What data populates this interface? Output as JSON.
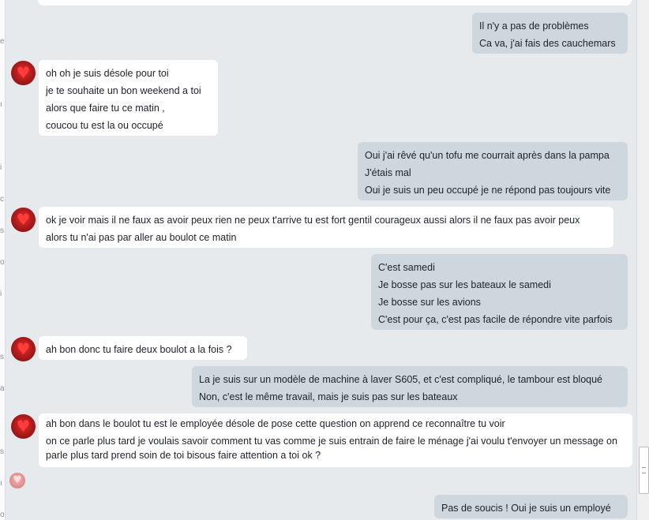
{
  "messages": [
    {
      "side": "out",
      "lines": [
        "Il n'y a pas de problèmes",
        "Ca va, j'ai fais des cauchemars"
      ]
    },
    {
      "side": "in",
      "lines": [
        "oh oh je suis désole  pour toi",
        "je te souhaite un bon weekend a toi",
        "alors que faire tu ce matin ,",
        "coucou tu est la ou occupé"
      ]
    },
    {
      "side": "out",
      "lines": [
        "Oui j'ai rêvé qu'un tofu me courrait après dans la pampa",
        "J'étais mal",
        "Oui je suis un peu occupé je ne répond pas toujours vite"
      ]
    },
    {
      "side": "in",
      "lines": [
        "ok je voir mais il ne faux as avoir peux rien ne peux t'arrive  tu est fort gentil courageux aussi alors il ne faux pas avoir peux",
        "alors tu n'ai pas par aller au boulot ce matin"
      ]
    },
    {
      "side": "out",
      "lines": [
        "C'est samedi",
        "Je bosse pas sur les bateaux le samedi",
        "Je bosse sur les avions",
        "C'est pour ça, c'est pas facile de répondre vite parfois"
      ]
    },
    {
      "side": "in",
      "lines": [
        "ah bon donc tu faire deux boulot a la fois ?"
      ]
    },
    {
      "side": "out",
      "lines": [
        "La je suis sur un modèle de machine à laver S605, et c'est compliqué, le tambour est bloqué",
        "Non, c'est le même travail, mais je suis pas sur les bateaux"
      ]
    },
    {
      "side": "in",
      "lines": [
        "ah bon dans le boulot tu est le employée désole de pose cette question on apprend ce reconnaître tu voir",
        "on ce parle plus tard je voulais savoir comment tu vas comme je suis entrain de faire le ménage  j'ai voulu t'envoyer un message on parle plus tard  prend soin de toi bisous faire attention a toi ok ?"
      ]
    },
    {
      "side": "out",
      "lines": [
        "Pas de soucis ! Oui je suis un employé"
      ]
    }
  ],
  "icons": {
    "avatar": "heart-avatar-icon"
  },
  "colors": {
    "background": "#e7eaed",
    "incoming_bubble": "#ffffff",
    "outgoing_bubble": "#cfd7de"
  }
}
